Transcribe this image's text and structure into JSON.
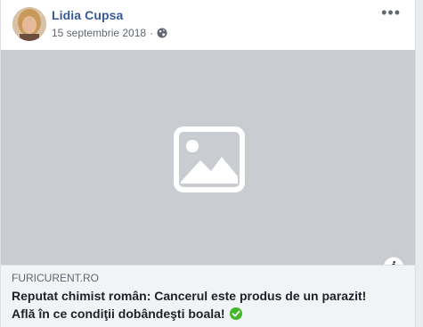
{
  "post": {
    "author": "Lidia Cupsa",
    "date": "15 septembrie 2018",
    "separator": "·",
    "privacy_icon": "globe-icon",
    "more_icon": "more-options-icon",
    "more_label": "•••"
  },
  "media": {
    "placeholder_icon": "image-placeholder-icon"
  },
  "link": {
    "domain": "FURICURENT.RO",
    "title_line1": "Reputat chimist român: Cancerul este produs de un parazit!",
    "title_line2": "Află în ce condiţii dobândeşti boala!",
    "badge_icon": "check-circle-icon",
    "info_label": "i"
  },
  "colors": {
    "author": "#385898",
    "badge": "#42b72a",
    "media_bg": "#c9ccd1"
  }
}
